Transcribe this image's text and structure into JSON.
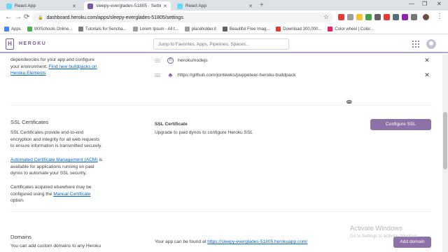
{
  "browser": {
    "tabs": [
      {
        "label": "React App",
        "active": false
      },
      {
        "label": "sleepy-everglades-51805 · Settin",
        "active": true
      },
      {
        "label": "React App",
        "active": false
      }
    ],
    "url": "dashboard.heroku.com/apps/sleepy-everglades-51805/settings",
    "bookmarks": [
      "Apps",
      "W3Schools Online...",
      "Tutorials for Sencha...",
      "Lorem Ipsum - All t...",
      "placeholder.it",
      "Beautiful Free Imag...",
      "Download 300,000...",
      "Color wheel | Color..."
    ]
  },
  "header": {
    "brand": "HEROKU",
    "search_placeholder": "Jump to Favorites, Apps, Pipelines, Spaces..."
  },
  "buildpacks": {
    "desc_line1": "dependencies for your app and configure",
    "desc_line2": "your environment. ",
    "desc_link_part1": "Find new buildpacks on",
    "desc_link_part2": "Heroku Elements",
    "items": [
      {
        "label": "heroku/nodejs",
        "icon": "heroku-icon"
      },
      {
        "label": "https://github.com/jontewks/puppeteer-heroku-buildpack",
        "icon": "github-icon"
      }
    ]
  },
  "ssl": {
    "title": "SSL Certificates",
    "p1": [
      "SSL Certificates provide end-to-end",
      "encryption and integrity for all web requests",
      "to ensure information is transmitted securely."
    ],
    "acm_link": "Automated Certificate Management (ACM)",
    "acm_suffix": " is",
    "p2": [
      "available for applications running on paid",
      "dynos to automate your SSL security."
    ],
    "p3": [
      "Certificates acquired elsewhere may be",
      "configured using the "
    ],
    "manual_link": "Manual Certificate",
    "p3_end": "option.",
    "cert_label": "SSL Certificate",
    "cert_text": "Upgrade to paid dynos to configure Heroku SSL",
    "configure_button": "Configure SSL"
  },
  "domains": {
    "title": "Domains",
    "desc": "You can add custom domains to any Heroku",
    "app_found_prefix": "Your app can be found at ",
    "app_url": "https://sleepy-everglades-51805.herokuapp.com/",
    "add_button": "Add domain"
  },
  "watermark": {
    "line1": "Activate Windows",
    "line2": "Go to Settings to activate Windows."
  },
  "colors": {
    "brand": "#79589f",
    "button": "#8d72a8",
    "link": "#0762c8"
  }
}
